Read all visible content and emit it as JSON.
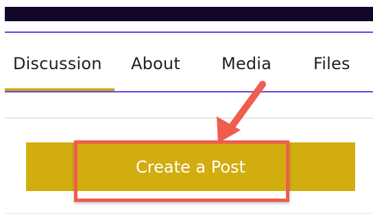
{
  "tabs": [
    {
      "label": "Discussion",
      "active": true
    },
    {
      "label": "About"
    },
    {
      "label": "Media"
    },
    {
      "label": "Files"
    }
  ],
  "main": {
    "create_post_label": "Create a Post"
  },
  "colors": {
    "top_bar": "#12062b",
    "accent_line": "#6b3fe0",
    "active_tab_underline": "#c9aa10",
    "button": "#d2ad0f",
    "annotation": "#ef5d4f"
  },
  "annotation": {
    "icon": "arrow-icon"
  }
}
